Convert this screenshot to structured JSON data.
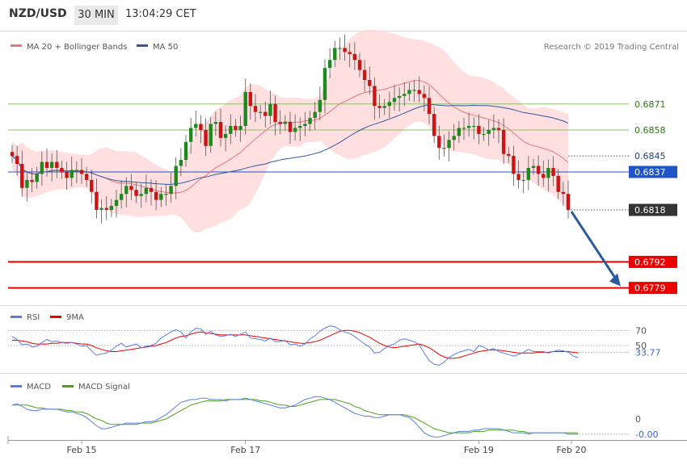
{
  "header": {
    "pair": "NZD/USD",
    "timeframe": "30 MIN",
    "time": "13:04:29 CET"
  },
  "copyright": "Research © 2019 Trading Central",
  "colors": {
    "up": "#1e8a1e",
    "down": "#cc1414",
    "ma50": "#2b5aa0",
    "ma20": "#e8777b",
    "band": "#ffd4d6",
    "support": "#ee0000",
    "resistance_green": "#8fbf6a",
    "blue_level": "#1f55c8",
    "last": "#333333",
    "rsi": "#5b7ee5",
    "rsi9": "#ee0000",
    "macd": "#5b7ee5",
    "macd_signal": "#4aa218"
  },
  "chart_data": [
    {
      "type": "candlestick",
      "title": "NZD/USD",
      "legend": [
        "MA 20 + Bollinger Bands",
        "MA 50"
      ],
      "x_ticks": [
        "Feb 15",
        "Feb 17",
        "Feb 19",
        "Feb 20"
      ],
      "y_range": [
        0.6774,
        0.6881
      ],
      "levels": [
        {
          "value": "0.6871",
          "kind": "resistance",
          "color": "#8fbf6a"
        },
        {
          "value": "0.6858",
          "kind": "resistance",
          "color": "#8fbf6a"
        },
        {
          "value": "0.6845",
          "kind": "ma",
          "color": "#ffffff"
        },
        {
          "value": "0.6837",
          "kind": "pivot",
          "color": "#1f55c8"
        },
        {
          "value": "0.6818",
          "kind": "last",
          "color": "#333333"
        },
        {
          "value": "0.6792",
          "kind": "support",
          "color": "#ee0000"
        },
        {
          "value": "0.6779",
          "kind": "support",
          "color": "#ee0000"
        }
      ],
      "closes": [
        0.6845,
        0.6841,
        0.6829,
        0.6833,
        0.6832,
        0.6836,
        0.6842,
        0.6839,
        0.6842,
        0.6839,
        0.6837,
        0.6834,
        0.6838,
        0.6838,
        0.6836,
        0.6833,
        0.6827,
        0.6818,
        0.6819,
        0.6818,
        0.682,
        0.6823,
        0.6826,
        0.683,
        0.6828,
        0.6825,
        0.6826,
        0.6829,
        0.6827,
        0.6823,
        0.6826,
        0.6826,
        0.683,
        0.684,
        0.6843,
        0.6852,
        0.6859,
        0.6861,
        0.6858,
        0.685,
        0.6861,
        0.6862,
        0.6854,
        0.6856,
        0.686,
        0.6858,
        0.686,
        0.6877,
        0.687,
        0.6867,
        0.6867,
        0.6865,
        0.6871,
        0.6862,
        0.6861,
        0.6862,
        0.6857,
        0.6859,
        0.686,
        0.6861,
        0.6864,
        0.6867,
        0.6873,
        0.6889,
        0.6893,
        0.6899,
        0.6899,
        0.6897,
        0.6896,
        0.6893,
        0.6888,
        0.6883,
        0.688,
        0.687,
        0.6869,
        0.687,
        0.6872,
        0.6874,
        0.6875,
        0.6876,
        0.6878,
        0.6878,
        0.6876,
        0.6874,
        0.6866,
        0.6855,
        0.6849,
        0.6849,
        0.6853,
        0.6855,
        0.6859,
        0.6859,
        0.686,
        0.686,
        0.6856,
        0.6856,
        0.6858,
        0.6859,
        0.6858,
        0.6846,
        0.6845,
        0.6836,
        0.6833,
        0.6833,
        0.6839,
        0.684,
        0.6836,
        0.6834,
        0.6839,
        0.6835,
        0.6827,
        0.6826,
        0.6818
      ],
      "ma20_label": "MA 20",
      "ma50_label": "MA 50"
    },
    {
      "type": "line",
      "legend": [
        "RSI",
        "9MA"
      ],
      "y_ticks": [
        "70",
        "50"
      ],
      "last_value": "33.77",
      "rsi": [
        62,
        58,
        51,
        52,
        48,
        49,
        54,
        58,
        55,
        56,
        54,
        53,
        54,
        52,
        49,
        50,
        43,
        37,
        39,
        40,
        44,
        49,
        53,
        48,
        50,
        52,
        47,
        49,
        50,
        53,
        60,
        64,
        68,
        71,
        68,
        60,
        68,
        73,
        72,
        65,
        69,
        64,
        62,
        63,
        65,
        62,
        65,
        68,
        60,
        59,
        58,
        56,
        60,
        55,
        55,
        57,
        51,
        52,
        49,
        52,
        59,
        63,
        69,
        73,
        76,
        75,
        71,
        68,
        66,
        62,
        57,
        52,
        48,
        40,
        41,
        46,
        50,
        52,
        57,
        59,
        57,
        55,
        51,
        40,
        30,
        25,
        24,
        28,
        34,
        38,
        41,
        43,
        45,
        42,
        50,
        48,
        44,
        46,
        42,
        40,
        38,
        36,
        38,
        41,
        45,
        42,
        42,
        42,
        40,
        42,
        44,
        43,
        41,
        36,
        34
      ],
      "ma9": [
        57,
        57,
        56,
        55,
        53,
        52,
        52,
        52,
        53,
        53,
        54,
        54,
        54,
        53,
        52,
        52,
        50,
        47,
        45,
        43,
        42,
        42,
        43,
        44,
        45,
        46,
        47,
        48,
        49,
        50,
        52,
        54,
        57,
        60,
        62,
        63,
        65,
        67,
        68,
        67,
        66,
        65,
        64,
        64,
        64,
        64,
        64,
        64,
        63,
        62,
        61,
        60,
        59,
        58,
        57,
        56,
        55,
        54,
        53,
        53,
        54,
        55,
        57,
        60,
        63,
        66,
        69,
        70,
        70,
        69,
        67,
        64,
        61,
        57,
        53,
        50,
        48,
        47,
        48,
        49,
        50,
        51,
        52,
        50,
        47,
        43,
        38,
        35,
        33,
        33,
        34,
        36,
        38,
        40,
        42,
        43,
        44,
        44,
        44,
        43,
        42,
        41,
        40,
        40,
        40,
        40,
        41,
        41,
        41,
        42,
        42,
        42,
        42,
        41,
        40
      ]
    },
    {
      "type": "line",
      "legend": [
        "MACD",
        "MACD Signal"
      ],
      "y_ticks": [
        "0"
      ],
      "last_value": "-0.00",
      "macd": [
        10,
        11,
        9,
        7,
        6,
        6,
        7,
        7,
        7,
        7,
        6,
        5,
        5,
        4,
        3,
        1,
        -2,
        -5,
        -7,
        -7,
        -6,
        -5,
        -4,
        -3,
        -3,
        -3,
        -3,
        -2,
        -2,
        -1,
        1,
        3,
        6,
        9,
        12,
        13,
        14,
        14,
        15,
        15,
        14,
        14,
        14,
        13,
        14,
        14,
        14,
        15,
        14,
        13,
        12,
        11,
        10,
        9,
        8,
        8,
        9,
        10,
        12,
        14,
        15,
        16,
        16,
        15,
        14,
        12,
        10,
        8,
        6,
        4,
        3,
        2,
        2,
        1,
        1,
        2,
        3,
        3,
        3,
        2,
        1,
        -2,
        -6,
        -10,
        -12,
        -13,
        -13,
        -12,
        -11,
        -10,
        -9,
        -9,
        -9,
        -8,
        -8,
        -7,
        -7,
        -7,
        -7,
        -8,
        -9,
        -10,
        -10,
        -10,
        -11,
        -10,
        -10,
        -10,
        -10,
        -10,
        -10,
        -10,
        -11,
        -11,
        -11
      ],
      "signal": [
        10,
        10,
        10,
        10,
        9,
        8,
        8,
        7,
        7,
        7,
        7,
        6,
        6,
        5,
        5,
        4,
        2,
        0,
        -1,
        -3,
        -4,
        -4,
        -4,
        -4,
        -4,
        -4,
        -3,
        -3,
        -3,
        -2,
        -1,
        0,
        2,
        4,
        6,
        8,
        10,
        11,
        12,
        13,
        13,
        13,
        13,
        14,
        14,
        14,
        14,
        14,
        14,
        14,
        13,
        13,
        12,
        11,
        10,
        10,
        9,
        9,
        10,
        11,
        12,
        13,
        14,
        14,
        14,
        14,
        13,
        12,
        11,
        9,
        8,
        6,
        5,
        4,
        3,
        3,
        3,
        3,
        3,
        3,
        2,
        1,
        -1,
        -3,
        -5,
        -7,
        -8,
        -9,
        -10,
        -10,
        -10,
        -10,
        -10,
        -9,
        -9,
        -9,
        -8,
        -8,
        -8,
        -8,
        -8,
        -8,
        -9,
        -9,
        -10,
        -10,
        -10,
        -10,
        -10,
        -10,
        -10,
        -10,
        -10,
        -10,
        -10
      ]
    }
  ]
}
